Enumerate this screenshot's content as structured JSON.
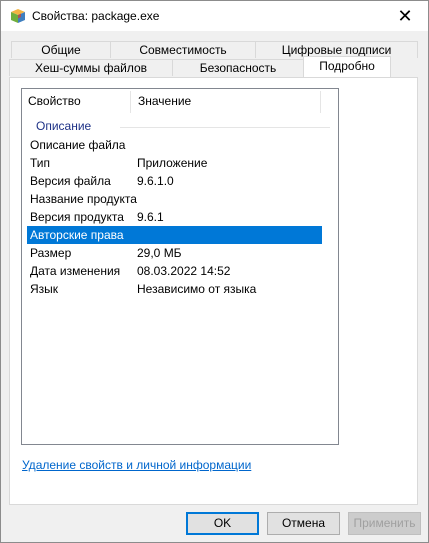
{
  "window": {
    "title": "Свойства: package.exe",
    "icon": "package-box-icon",
    "close_glyph": "✕"
  },
  "tabs": {
    "row1": [
      "Общие",
      "Совместимость",
      "Цифровые подписи"
    ],
    "row2": [
      "Хеш-суммы файлов",
      "Безопасность",
      "Подробно"
    ],
    "active": "Подробно"
  },
  "list": {
    "headers": {
      "property": "Свойство",
      "value": "Значение"
    },
    "group": "Описание",
    "rows": [
      {
        "property": "Описание файла",
        "value": ""
      },
      {
        "property": "Тип",
        "value": "Приложение"
      },
      {
        "property": "Версия файла",
        "value": "9.6.1.0"
      },
      {
        "property": "Название продукта",
        "value": ""
      },
      {
        "property": "Версия продукта",
        "value": "9.6.1"
      },
      {
        "property": "Авторские права",
        "value": ""
      },
      {
        "property": "Размер",
        "value": "29,0 МБ"
      },
      {
        "property": "Дата изменения",
        "value": "08.03.2022 14:52"
      },
      {
        "property": "Язык",
        "value": "Независимо от языка"
      }
    ],
    "selected_index": 5
  },
  "link_text": "Удаление свойств и личной информации",
  "buttons": {
    "ok": "OK",
    "cancel": "Отмена",
    "apply": "Применить"
  },
  "colors": {
    "selection": "#0078d7",
    "group_header": "#1e3287",
    "link": "#0066cc"
  }
}
